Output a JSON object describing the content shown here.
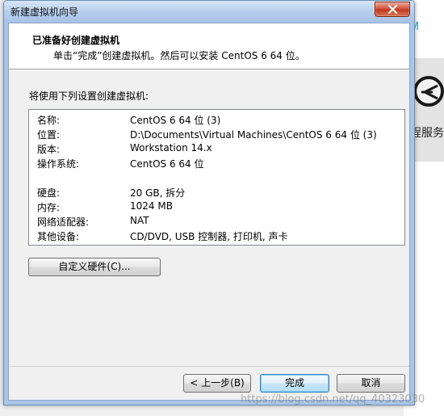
{
  "background_app": {
    "letter": "M",
    "text": "程服务"
  },
  "window": {
    "title": "新建虚拟机向导"
  },
  "header": {
    "title": "已准备好创建虚拟机",
    "subtitle": "单击“完成”创建虚拟机。然后可以安装 CentOS 6 64 位。"
  },
  "intro": "将使用下列设置创建虚拟机:",
  "summary": [
    {
      "key": "名称:",
      "value": "CentOS 6 64 位 (3)"
    },
    {
      "key": "位置:",
      "value": "D:\\Documents\\Virtual Machines\\CentOS 6 64 位 (3)"
    },
    {
      "key": "版本:",
      "value": "Workstation 14.x"
    },
    {
      "key": "操作系统:",
      "value": "CentOS 6 64 位"
    },
    {
      "key": "硬盘:",
      "value": "20 GB, 拆分"
    },
    {
      "key": "内存:",
      "value": "1024 MB"
    },
    {
      "key": "网络适配器:",
      "value": "NAT"
    },
    {
      "key": "其他设备:",
      "value": "CD/DVD, USB 控制器, 打印机, 声卡"
    }
  ],
  "buttons": {
    "customize": "自定义硬件(C)...",
    "back": "< 上一步(B)",
    "finish": "完成",
    "cancel": "取消"
  },
  "watermark": "https://blog.csdn.net/qq_40323030",
  "colors": {
    "titlebar": "#b7cfed",
    "close_button": "#d4553b",
    "default_button_border": "#3c7fb1"
  },
  "icons": {
    "close": "close-icon",
    "background_logo": "circle-arrow-icon"
  }
}
